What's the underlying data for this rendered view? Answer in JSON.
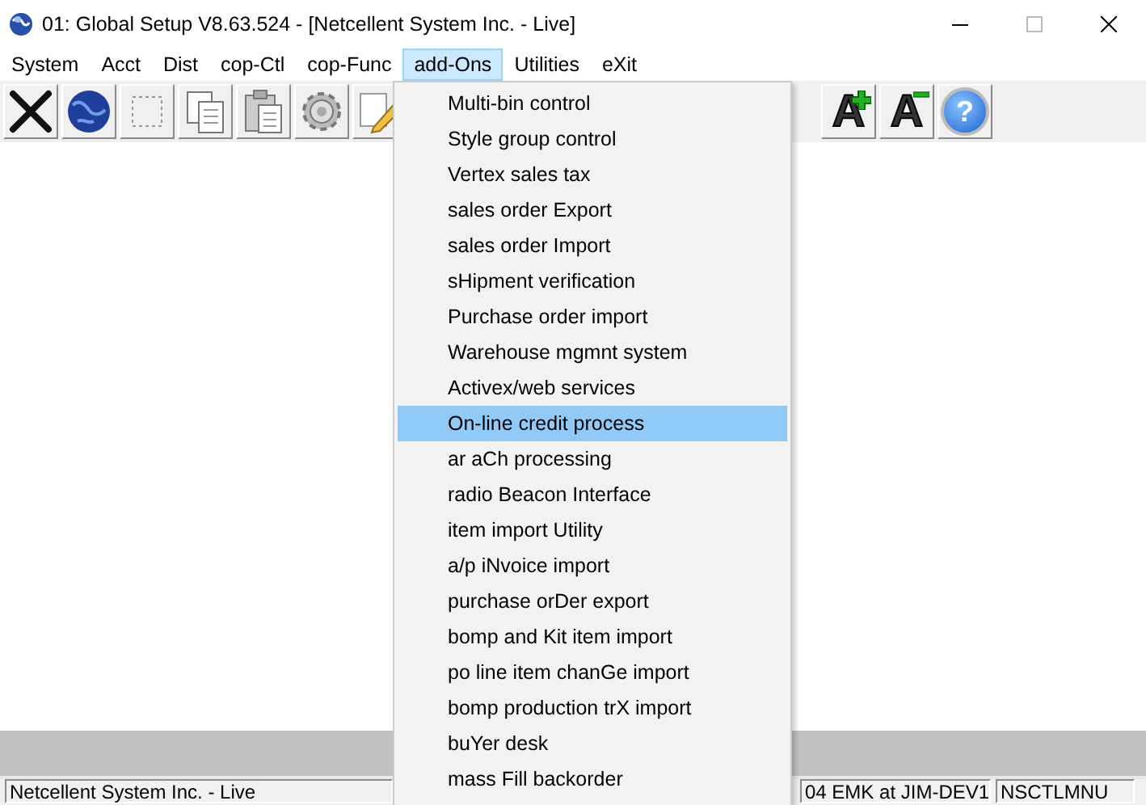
{
  "window": {
    "title": "01: Global Setup V8.63.524 - [Netcellent System Inc. - Live]"
  },
  "menu_bar": [
    {
      "label": "System",
      "selected": false
    },
    {
      "label": "Acct",
      "selected": false
    },
    {
      "label": "Dist",
      "selected": false
    },
    {
      "label": "cop-Ctl",
      "selected": false
    },
    {
      "label": "cop-Func",
      "selected": false
    },
    {
      "label": "add-Ons",
      "selected": true
    },
    {
      "label": "Utilities",
      "selected": false
    },
    {
      "label": "eXit",
      "selected": false
    }
  ],
  "toolbar": {
    "left": [
      {
        "kind": "tools"
      },
      {
        "kind": "globe"
      },
      {
        "kind": "select"
      },
      {
        "kind": "copy"
      },
      {
        "kind": "paste"
      },
      {
        "kind": "settings"
      },
      {
        "kind": "edit"
      }
    ],
    "right": [
      {
        "kind": "increase",
        "label": "A"
      },
      {
        "kind": "decrease",
        "label": "A"
      },
      {
        "kind": "help",
        "label": "?"
      }
    ]
  },
  "dropdown": [
    {
      "label": "Multi-bin control",
      "selected": false
    },
    {
      "label": "Style group control",
      "selected": false
    },
    {
      "label": "Vertex sales tax",
      "selected": false
    },
    {
      "label": "sales order Export",
      "selected": false
    },
    {
      "label": "sales order Import",
      "selected": false
    },
    {
      "label": "sHipment verification",
      "selected": false
    },
    {
      "label": "Purchase order import",
      "selected": false
    },
    {
      "label": "Warehouse mgmnt system",
      "selected": false
    },
    {
      "label": "Activex/web services",
      "selected": false
    },
    {
      "label": "On-line credit process",
      "selected": true
    },
    {
      "label": "ar aCh processing",
      "selected": false
    },
    {
      "label": "radio Beacon Interface",
      "selected": false
    },
    {
      "label": "item import Utility",
      "selected": false
    },
    {
      "label": "a/p iNvoice import",
      "selected": false
    },
    {
      "label": "purchase orDer export",
      "selected": false
    },
    {
      "label": "bomp and Kit item import",
      "selected": false
    },
    {
      "label": "po line item chanGe import",
      "selected": false
    },
    {
      "label": "bomp production trX import",
      "selected": false
    },
    {
      "label": "buYer desk",
      "selected": false
    },
    {
      "label": "mass Fill backorder",
      "selected": false
    }
  ],
  "status_bar": [
    {
      "text": "Netcellent System Inc. - Live"
    },
    {
      "text": "04 EMK at JIM-DEV1"
    },
    {
      "text": "NSCTLMNU"
    }
  ]
}
